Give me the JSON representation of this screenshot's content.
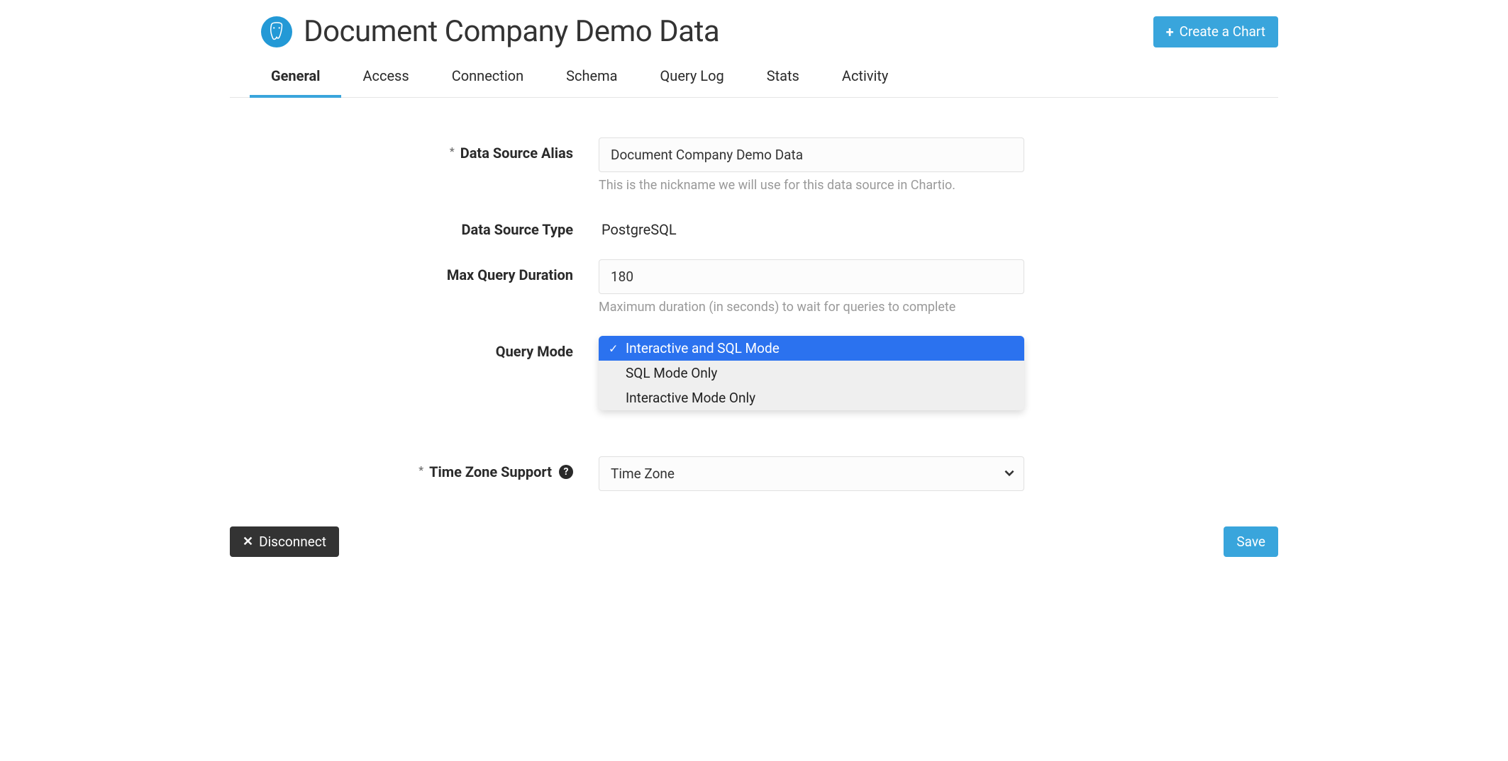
{
  "header": {
    "title": "Document Company Demo Data",
    "create_chart_label": "Create a Chart"
  },
  "tabs": [
    "General",
    "Access",
    "Connection",
    "Schema",
    "Query Log",
    "Stats",
    "Activity"
  ],
  "active_tab": 0,
  "form": {
    "alias": {
      "label": "Data Source Alias",
      "value": "Document Company Demo Data",
      "help": "This is the nickname we will use for this data source in Chartio.",
      "required": true
    },
    "type": {
      "label": "Data Source Type",
      "value": "PostgreSQL"
    },
    "max_query": {
      "label": "Max Query Duration",
      "value": "180",
      "help": "Maximum duration (in seconds) to wait for queries to complete"
    },
    "query_mode": {
      "label": "Query Mode",
      "options": [
        "Interactive and SQL Mode",
        "SQL Mode Only",
        "Interactive Mode Only"
      ],
      "selected_index": 0
    },
    "timezone": {
      "label": "Time Zone Support",
      "value": "Time Zone",
      "required": true
    }
  },
  "footer": {
    "disconnect_label": "Disconnect",
    "save_label": "Save"
  }
}
